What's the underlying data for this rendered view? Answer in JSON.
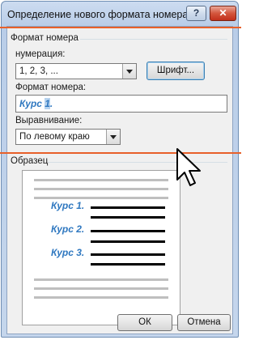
{
  "window": {
    "title": "Определение нового формата номера",
    "help_label": "?",
    "close_label": "✕"
  },
  "group": {
    "title": "Формат номера"
  },
  "numbering": {
    "label": "нумерация:",
    "value": "1, 2, 3, ..."
  },
  "font_button": {
    "label": "Шрифт..."
  },
  "format": {
    "label": "Формат номера:",
    "value_prefix": "Курс ",
    "value_selected": "1",
    "value_suffix": "."
  },
  "alignment": {
    "label": "Выравнивание:",
    "value": "По левому краю"
  },
  "preview": {
    "label": "Образец",
    "items": [
      "Курс 1.",
      "Курс 2.",
      "Курс 3."
    ]
  },
  "buttons": {
    "ok": "ОК",
    "cancel": "Отмена"
  },
  "colors": {
    "accent": "#2f78c0",
    "highlight_line": "#e8602a"
  },
  "icons": {
    "cursor": "mouse-pointer-icon"
  }
}
